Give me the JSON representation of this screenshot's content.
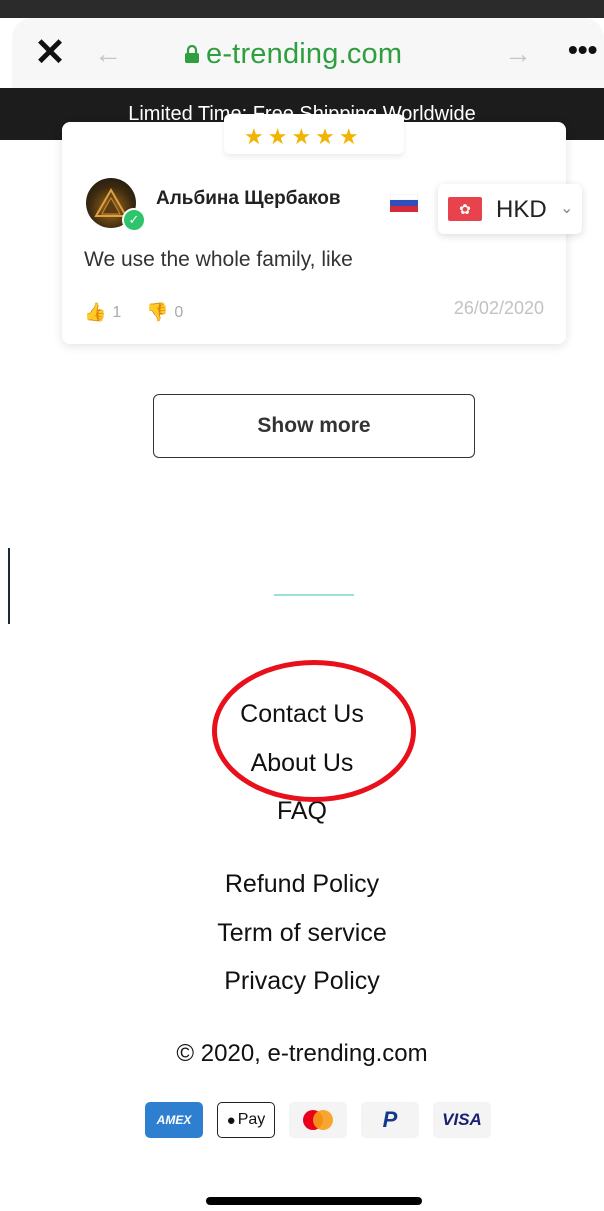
{
  "browser": {
    "close_icon": "close-icon",
    "back_icon": "back-arrow-icon",
    "forward_icon": "forward-arrow-icon",
    "url": "e-trending.com",
    "more_icon": "more-icon"
  },
  "announcement": "Limited Time: Free Shipping Worldwide",
  "review": {
    "stars": "★★★★★",
    "reviewer": "Альбина Щербаков",
    "text": "We use the whole family, like",
    "likes": "1",
    "dislikes": "0",
    "date": "26/02/2020"
  },
  "currency": {
    "code": "HKD"
  },
  "show_more": "Show more",
  "footer": {
    "links": [
      "Contact Us",
      "About Us",
      "FAQ",
      "Refund Policy",
      "Term of service",
      "Privacy Policy"
    ],
    "copyright": "© 2020, e-trending.com"
  },
  "payments": {
    "amex": "AMEX",
    "applepay": "Pay",
    "visa": "VISA",
    "paypal": "P"
  },
  "colors": {
    "url_green": "#2e9e3f",
    "announce_bg": "#1c1c1c",
    "highlight_red": "#e8101a",
    "accent_teal": "#9be0d3"
  }
}
